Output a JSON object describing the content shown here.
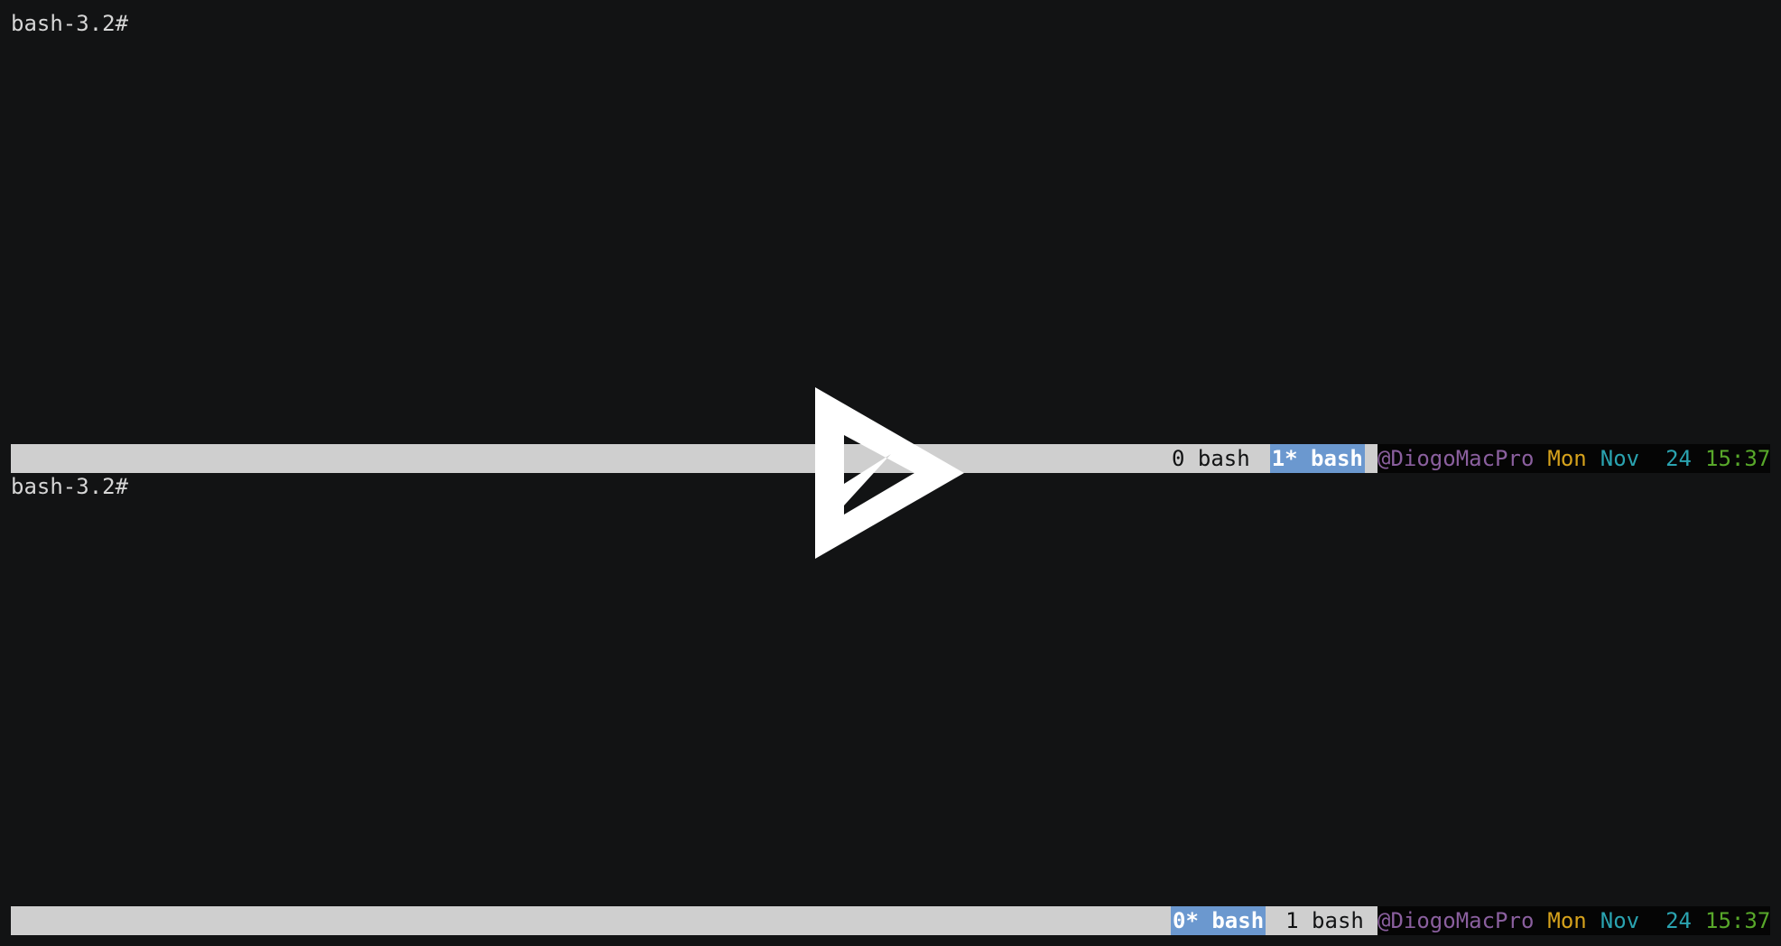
{
  "panes": [
    {
      "prompt": "bash-3.2#"
    },
    {
      "prompt": "bash-3.2#"
    }
  ],
  "status_top": {
    "windows": [
      {
        "label": "0 bash",
        "active": false
      },
      {
        "label": "1* bash",
        "active": true
      }
    ],
    "host": "@DiogoMacPro",
    "day": "Mon",
    "month": "Nov",
    "date": "24",
    "time": "15:37"
  },
  "status_bottom": {
    "windows": [
      {
        "label": "0* bash",
        "active": true
      },
      {
        "label": "1 bash",
        "active": false
      }
    ],
    "host": "@DiogoMacPro",
    "day": "Mon",
    "month": "Nov",
    "date": "24",
    "time": "15:37"
  },
  "colors": {
    "background": "#121314",
    "statusbar": "#cfcfcf",
    "active_window": "#6b98cf",
    "host": "#8a5f9e",
    "day": "#d6a21c",
    "month": "#2aa3b0",
    "datetime": "#58a82a"
  },
  "overlay": {
    "icon": "play-icon"
  }
}
